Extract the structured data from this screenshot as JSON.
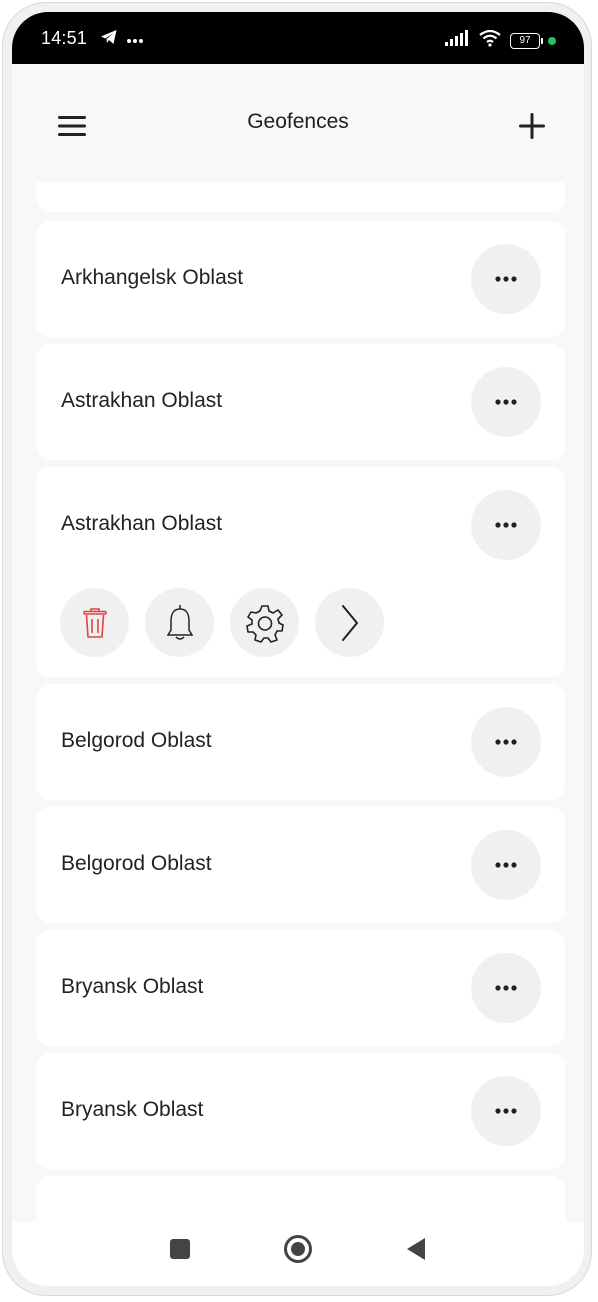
{
  "status_bar": {
    "time": "14:51",
    "battery": "97",
    "icons": [
      "telegram-icon",
      "more-dots-icon",
      "signal-icon",
      "wifi-icon",
      "battery-icon",
      "charging-dot-icon"
    ],
    "charge_color": "#22c55e"
  },
  "header": {
    "title": "Geofences",
    "menu_icon": "hamburger-icon",
    "add_icon": "plus-icon"
  },
  "geofences": [
    {
      "label": "Arkhangelsk Oblast"
    },
    {
      "label": "Astrakhan Oblast"
    },
    {
      "label": "Astrakhan Oblast",
      "expanded": true
    },
    {
      "label": "Belgorod Oblast"
    },
    {
      "label": "Belgorod Oblast"
    },
    {
      "label": "Bryansk Oblast"
    },
    {
      "label": "Bryansk Oblast"
    }
  ],
  "expanded_actions": [
    "trash-icon",
    "bell-icon",
    "gear-icon",
    "chevron-right-icon"
  ],
  "colors": {
    "delete_red": "#e0443e",
    "background": "#f8f8f8",
    "card": "#ffffff",
    "button_bg": "#f0f0f0"
  },
  "nav_bar": {
    "icons": [
      "square-recent-icon",
      "circle-home-icon",
      "triangle-back-icon"
    ]
  }
}
